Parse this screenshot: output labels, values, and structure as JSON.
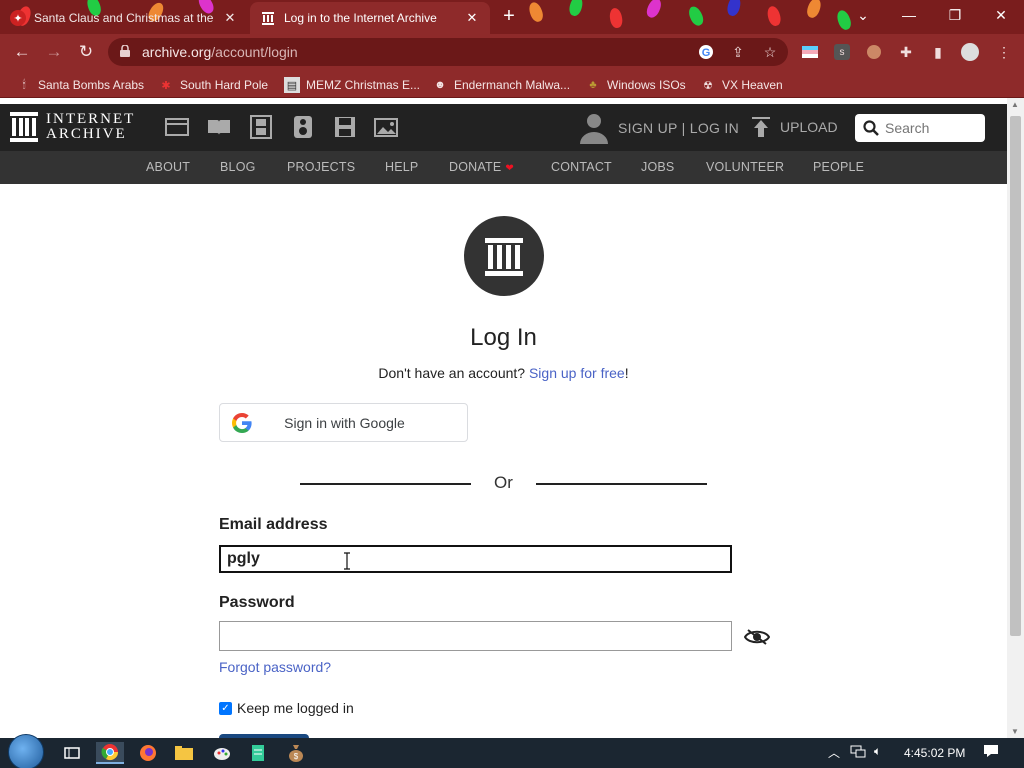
{
  "browser": {
    "tabs": [
      {
        "title": "Santa Claus and Christmas at the",
        "active": false
      },
      {
        "title": "Log in to the Internet Archive",
        "active": true
      }
    ],
    "new_tab_label": "+",
    "url_host": "archive.org",
    "url_path": "/account/login",
    "bookmarks": [
      "Santa Bombs Arabs",
      "South Hard Pole",
      "MEMZ Christmas E...",
      "Endermanch Malwa...",
      "Windows ISOs",
      "VX Heaven"
    ],
    "theme_color": "#8e2a2a"
  },
  "ia_header": {
    "logo_line1": "INTERNET",
    "logo_line2": "ARCHIVE",
    "signup_login": "SIGN UP | LOG IN",
    "upload": "UPLOAD",
    "search_placeholder": "Search"
  },
  "ia_nav": [
    "ABOUT",
    "BLOG",
    "PROJECTS",
    "HELP",
    "DONATE",
    "CONTACT",
    "JOBS",
    "VOLUNTEER",
    "PEOPLE"
  ],
  "login": {
    "title": "Log In",
    "no_account_text": "Don't have an account?",
    "signup_link": "Sign up for free",
    "signup_suffix": "!",
    "google_button": "Sign in with Google",
    "or_text": "Or",
    "email_label": "Email address",
    "email_value": "pgly",
    "password_label": "Password",
    "password_value": "",
    "forgot_link": "Forgot password?",
    "keep_logged_in": "Keep me logged in",
    "keep_logged_in_checked": true
  },
  "taskbar": {
    "clock": "4:45:02 PM"
  }
}
